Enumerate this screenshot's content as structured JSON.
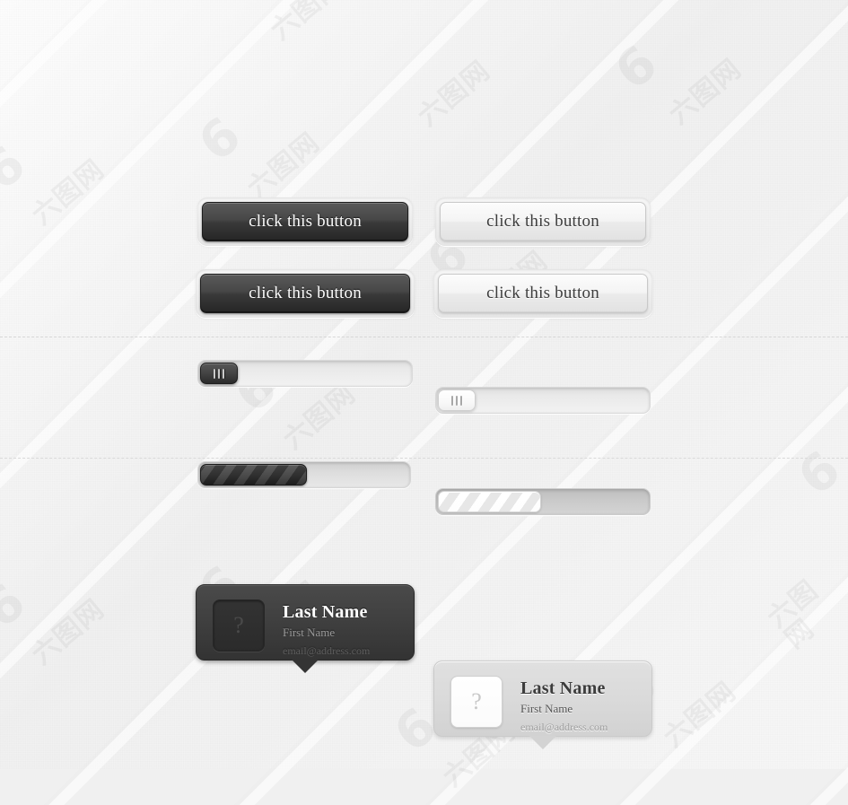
{
  "page": {
    "background_color": "#f0f0f0",
    "watermark_logo": "6",
    "watermark_text": "六图网"
  },
  "buttons": {
    "row1": [
      {
        "label": "click this button",
        "theme": "dark",
        "name": "button-dark-1"
      },
      {
        "label": "click this button",
        "theme": "light",
        "name": "button-light-1"
      }
    ],
    "row2": [
      {
        "label": "click this button",
        "theme": "dark",
        "name": "button-dark-2"
      },
      {
        "label": "click this button",
        "theme": "light",
        "name": "button-light-2"
      }
    ]
  },
  "sliders": [
    {
      "theme": "dark",
      "value_percent": 0,
      "grip_icon": "grip-lines-icon",
      "name": "slider-dark"
    },
    {
      "theme": "light",
      "value_percent": 0,
      "grip_icon": "grip-lines-icon",
      "name": "slider-light"
    }
  ],
  "progress_bars": [
    {
      "theme": "dark",
      "value_percent": 52,
      "name": "progress-bar-dark"
    },
    {
      "theme": "light",
      "value_percent": 50,
      "name": "progress-bar-light"
    }
  ],
  "cards": [
    {
      "theme": "dark",
      "avatar_placeholder": "?",
      "last_name": "Last Name",
      "first_name": "First Name",
      "email": "email@address.com",
      "name": "contact-card-dark"
    },
    {
      "theme": "light",
      "avatar_placeholder": "?",
      "last_name": "Last Name",
      "first_name": "First Name",
      "email": "email@address.com",
      "name": "contact-card-light"
    }
  ],
  "colors": {
    "dark_face": "#3a3a3a",
    "light_face": "#ebebeb",
    "card_dark": "#3f3f3f",
    "card_light": "#dadada",
    "divider": "#d8d8d8"
  }
}
